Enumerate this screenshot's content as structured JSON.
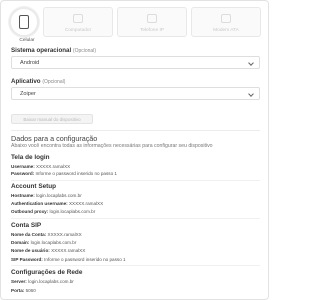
{
  "devices": [
    {
      "label": "Celular",
      "active": true
    },
    {
      "label": "Computador",
      "active": false
    },
    {
      "label": "Telefone IP",
      "active": false
    },
    {
      "label": "Modem ATA",
      "active": false
    }
  ],
  "os_field": {
    "label": "Sistema operacional",
    "optional": "(Opcional)",
    "value": "Android"
  },
  "app_field": {
    "label": "Aplicativo",
    "optional": "(Opcional)",
    "value": "Zoiper"
  },
  "manual_button": "Baixar manual do dispositivo",
  "config": {
    "title": "Dados para a configuração",
    "subtitle": "Abaixo você encontra todas as informações necessárias para configurar seu dispositivo",
    "login_screen": {
      "title": "Tela de login",
      "username_key": "Username:",
      "username_val": "XXXXX.ramalXX",
      "password_key": "Password:",
      "password_val": "Informe o password inserido no passo 1"
    },
    "account_setup": {
      "title": "Account Setup",
      "hostname_key": "Hostname:",
      "hostname_val": "login.locaplabs.com.br",
      "auth_key": "Authentication username:",
      "auth_val": "XXXXX.ramalXX",
      "proxy_key": "Outbound proxy:",
      "proxy_val": "login.locaplabs.com.br"
    },
    "sip": {
      "title": "Conta SIP",
      "name_key": "Nome da Conta:",
      "name_val": "XXXXX.ramalXX",
      "domain_key": "Domain:",
      "domain_val": "login.locaplabs.com.br",
      "user_key": "Nome de usuário:",
      "user_val": "XXXXX.ramalXX",
      "pass_key": "SIP Password:",
      "pass_val": "Informe o password inserido no passo 1"
    },
    "network": {
      "title": "Configurações de Rede",
      "server_key": "Server:",
      "server_val": "login.locaplabs.com.br",
      "port_key": "Porta:",
      "port_val": "5060"
    }
  }
}
